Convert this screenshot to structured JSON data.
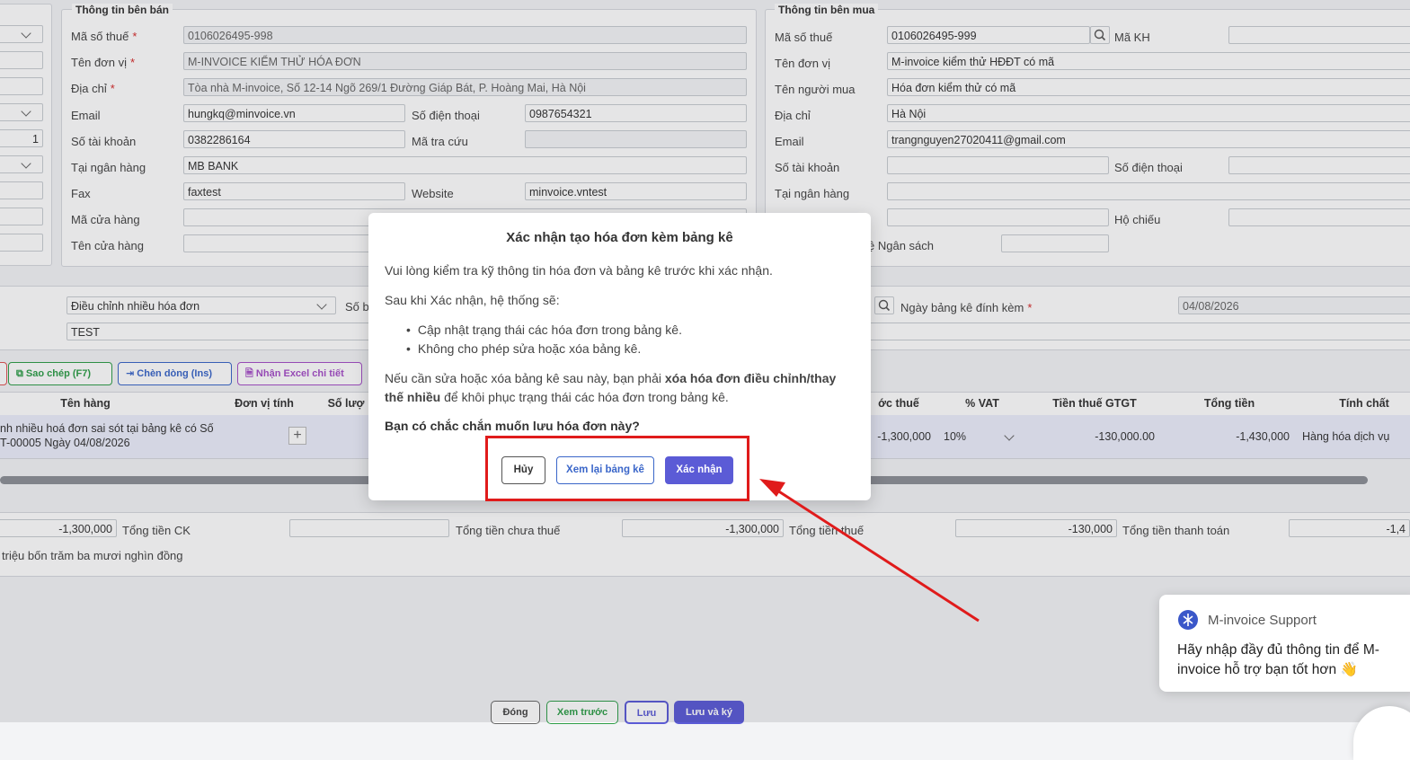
{
  "seller": {
    "title": "Thông tin bên bán",
    "labels": {
      "tax": "Mã số thuế",
      "name": "Tên đơn vị",
      "address": "Địa chỉ",
      "email": "Email",
      "phone": "Số điện thoại",
      "account": "Số tài khoản",
      "lookup": "Mã tra cứu",
      "bank": "Tại ngân hàng",
      "fax": "Fax",
      "website": "Website",
      "store_code": "Mã cửa hàng",
      "store_name": "Tên cửa hàng"
    },
    "values": {
      "tax": "0106026495-998",
      "name": "M-INVOICE KIỂM THỬ HÓA ĐƠN",
      "address": "Tòa nhà M-invoice, Số 12-14 Ngõ 269/1 Đường Giáp Bát, P. Hoàng Mai, Hà Nội",
      "email": "hungkq@minvoice.vn",
      "phone": "0987654321",
      "account": "0382286164",
      "bank": "MB BANK",
      "fax": "faxtest",
      "website": "minvoice.vntest"
    }
  },
  "left_strip": {
    "value": "1"
  },
  "buyer": {
    "title": "Thông tin bên mua",
    "labels": {
      "tax": "Mã số thuế",
      "customer_code": "Mã KH",
      "name": "Tên đơn vị",
      "buyer": "Tên người mua",
      "address": "Địa chỉ",
      "email": "Email",
      "account": "Số tài khoản",
      "phone": "Số điện thoại",
      "bank": "Tại ngân hàng",
      "passport": "Hộ chiếu",
      "budget": "ệ Ngân sách"
    },
    "values": {
      "tax": "0106026495-999",
      "name": "M-invoice kiểm thử HĐĐT có mã",
      "buyer": "Hóa đơn kiểm thử có mã",
      "address": "Hà Nội",
      "email": "trangnguyen27020411@gmail.com"
    }
  },
  "invoice": {
    "adjust_select": "Điều chỉnh nhiều hóa đơn",
    "so_label": "Số b",
    "note": "TEST",
    "attach_date_label": "Ngày bảng kê đính kèm",
    "attach_date": "04/08/2026"
  },
  "toolbar": {
    "copy": "Sao chép (F7)",
    "insert": "Chèn dòng (Ins)",
    "import": "Nhận Excel chi tiết"
  },
  "table": {
    "headers": {
      "name": "Tên hàng",
      "unit": "Đơn vị tính",
      "qty": "Số lượ",
      "pretax": "ớc thuế",
      "vat": "% VAT",
      "vat_amount": "Tiền thuế GTGT",
      "total": "Tổng tiền",
      "nature": "Tính chất"
    },
    "row": {
      "name_line1": "nh nhiều hoá đơn sai sót tại bảng kê có Số",
      "name_line2": "T-00005 Ngày 04/08/2026",
      "pretax": "-1,300,000",
      "vat": "10%",
      "vat_amount": "-130,000.00",
      "total": "-1,430,000",
      "nature": "Hàng hóa dịch vụ"
    }
  },
  "totals": {
    "first": "-1,300,000",
    "ck_label": "Tổng tiền CK",
    "pretax_label": "Tổng tiền chưa thuế",
    "pretax": "-1,300,000",
    "tax_label": "Tổng tiền thuế",
    "tax": "-130,000",
    "pay_label": "Tổng tiền thanh toán",
    "pay": "-1,4",
    "words": "triệu bốn trăm ba mươi nghìn đồng"
  },
  "footer": {
    "close": "Đóng",
    "preview": "Xem trước",
    "save": "Lưu",
    "save_sign": "Lưu và ký"
  },
  "modal": {
    "title": "Xác nhận tạo hóa đơn kèm bảng kê",
    "line1": "Vui lòng kiểm tra kỹ thông tin hóa đơn và bảng kê trước khi xác nhận.",
    "line2": "Sau khi Xác nhận, hệ thống sẽ:",
    "bullet1": "Cập nhật trạng thái các hóa đơn trong bảng kê.",
    "bullet2": "Không cho phép sửa hoặc xóa bảng kê.",
    "warn_pre": "Nếu cần sửa hoặc xóa bảng kê sau này, bạn phải ",
    "warn_bold1": "xóa hóa đơn điều chỉnh/thay",
    "warn_bold2": "thế nhiều",
    "warn_post": " để khôi phục trạng thái các hóa đơn trong bảng kê.",
    "question": "Bạn có chắc chắn muốn lưu hóa đơn này?",
    "cancel": "Hủy",
    "review": "Xem lại bảng kê",
    "confirm": "Xác nhận"
  },
  "chat": {
    "title": "M-invoice Support",
    "msg1": "Hãy nhập đầy đủ thông tin để M-",
    "msg2": "invoice hỗ trợ bạn tốt hơn 👋"
  },
  "colors": {
    "accent": "#5b5bd6",
    "green": "#2e9e48",
    "blue": "#3a66c9",
    "purple": "#a64fc8",
    "red": "#e01b1b"
  }
}
